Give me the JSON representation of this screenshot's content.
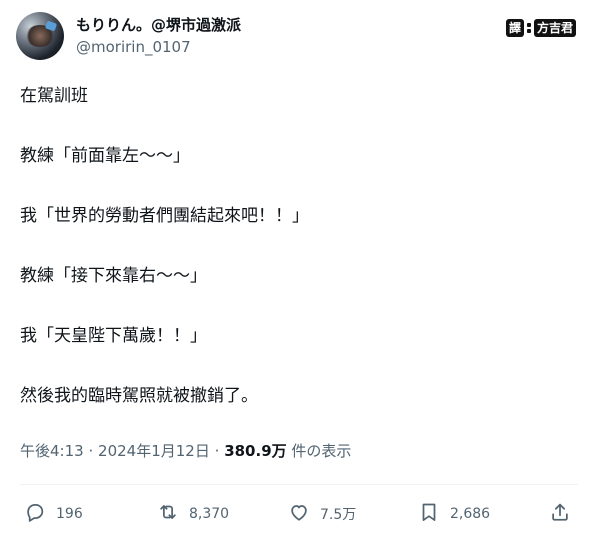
{
  "author": {
    "display_name": "もりりん。@堺市過激派",
    "handle": "@moririn_0107"
  },
  "translate_badge": {
    "left": "譯",
    "right": "方吉君"
  },
  "tweet_lines": [
    "在駕訓班",
    "教練「前面靠左〜〜」",
    "我「世界的勞動者們團結起來吧！！」",
    "教練「接下來靠右〜〜」",
    "我「天皇陛下萬歲！！」",
    "然後我的臨時駕照就被撤銷了。"
  ],
  "meta": {
    "time": "午後4:13",
    "date": "2024年1月12日",
    "separator": "·",
    "views": "380.9万",
    "views_label": "件の表示"
  },
  "actions": {
    "reply": {
      "icon": "reply-icon",
      "count": "196"
    },
    "retweet": {
      "icon": "retweet-icon",
      "count": "8,370"
    },
    "like": {
      "icon": "heart-icon",
      "count": "7.5万"
    },
    "bookmark": {
      "icon": "bookmark-icon",
      "count": "2,686"
    },
    "share": {
      "icon": "share-icon"
    }
  }
}
